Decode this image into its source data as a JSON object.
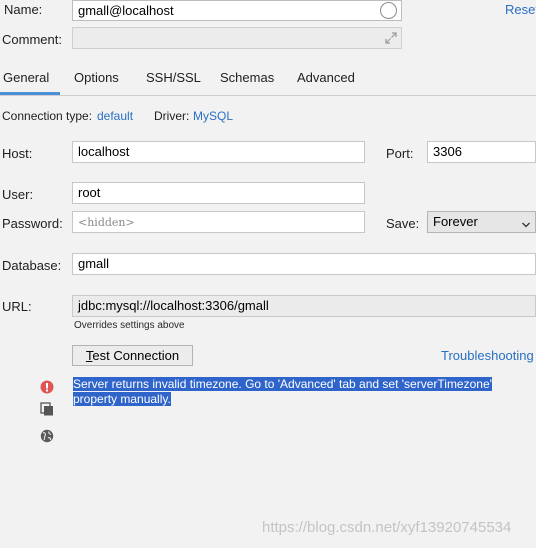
{
  "name": {
    "label": "Name:",
    "value": "gmall@localhost"
  },
  "reset_label": "Reset",
  "comment": {
    "label": "Comment:",
    "value": ""
  },
  "tabs": [
    {
      "label": "General",
      "active": true
    },
    {
      "label": "Options",
      "active": false
    },
    {
      "label": "SSH/SSL",
      "active": false
    },
    {
      "label": "Schemas",
      "active": false
    },
    {
      "label": "Advanced",
      "active": false
    }
  ],
  "connection_type": {
    "label": "Connection type:",
    "value": "default"
  },
  "driver": {
    "label": "Driver:",
    "value": "MySQL"
  },
  "host": {
    "label": "Host:",
    "value": "localhost"
  },
  "port": {
    "label": "Port:",
    "value": "3306"
  },
  "user": {
    "label": "User:",
    "value": "root"
  },
  "password": {
    "label": "Password:",
    "placeholder": "<hidden>"
  },
  "save": {
    "label": "Save:",
    "value": "Forever"
  },
  "database": {
    "label": "Database:",
    "value": "gmall"
  },
  "url": {
    "label": "URL:",
    "value": "jdbc:mysql://localhost:3306/gmall",
    "hint": "Overrides settings above"
  },
  "test_connection": {
    "prefix": "T",
    "rest": "est Connection"
  },
  "troubleshooting_label": "Troubleshooting",
  "error_message": {
    "line1": "Server returns invalid timezone. Go to 'Advanced' tab and set 'serverTimezone'",
    "line2": "property manually."
  },
  "watermark": "https://blog.csdn.net/xyf13920745534",
  "colors": {
    "accent": "#2a6fc2",
    "selection": "#2f65ca",
    "error": "#e05555"
  }
}
